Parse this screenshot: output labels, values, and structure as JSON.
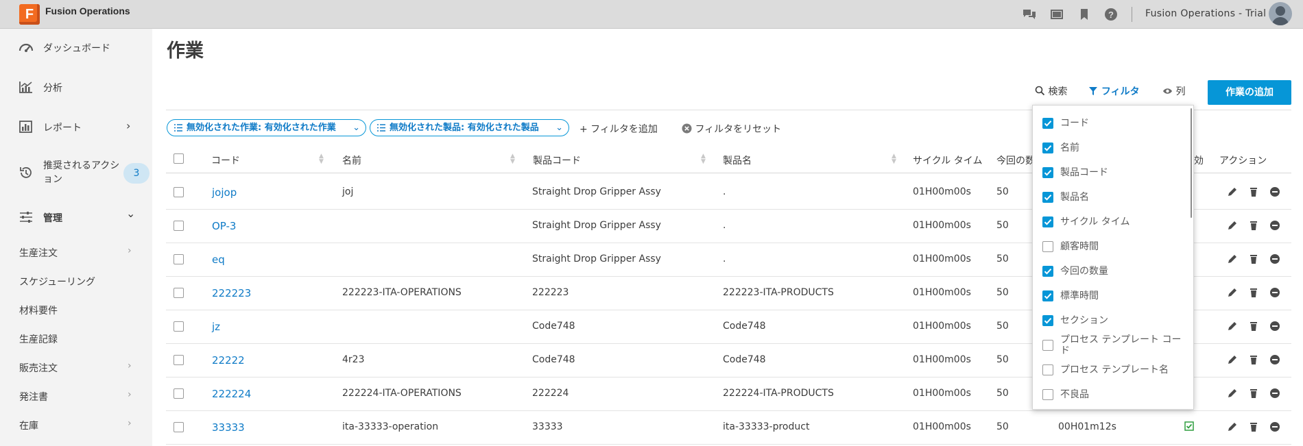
{
  "app": {
    "logo_letter": "F",
    "title": "Fusion Operations",
    "account": "Fusion Operations - Trial"
  },
  "topbar_icons": [
    "chat-icon",
    "screen-icon",
    "bookmark-icon",
    "help-icon"
  ],
  "sidebar": {
    "main_items": [
      {
        "label": "ダッシュボード",
        "icon": "dashboard-icon"
      },
      {
        "label": "分析",
        "icon": "analytics-icon"
      },
      {
        "label": "レポート",
        "icon": "report-icon",
        "chevron": "›"
      },
      {
        "label": "推奨されるアクション",
        "icon": "history-icon",
        "badge": "3"
      },
      {
        "label": "管理",
        "icon": "sliders-icon",
        "chevron": "⌄"
      }
    ],
    "sub_items": [
      {
        "label": "生産注文",
        "chevron": "›"
      },
      {
        "label": "スケジューリング"
      },
      {
        "label": "材料要件"
      },
      {
        "label": "生産記録"
      },
      {
        "label": "販売注文",
        "chevron": "›"
      },
      {
        "label": "発注書",
        "chevron": "›"
      },
      {
        "label": "在庫",
        "chevron": "›"
      }
    ]
  },
  "page": {
    "title": "作業"
  },
  "toolbar": {
    "search": "検索",
    "filter": "フィルタ",
    "columns": "列",
    "add": "作業の追加"
  },
  "filters": {
    "chips": [
      "無効化された作業: 有効化された作業",
      "無効化された製品: 有効化された製品"
    ],
    "add_filter": "+ フィルタを追加",
    "reset_filter": "フィルタをリセット"
  },
  "table": {
    "headers": {
      "code": "コード",
      "name": "名前",
      "product_code": "製品コード",
      "product_name": "製品名",
      "cycle_time": "サイクル タイム",
      "quantity": "今回の数",
      "enabled": "効",
      "actions": "アクション"
    },
    "rows": [
      {
        "code": "jojop",
        "name": "joj",
        "product_code": "Straight Drop Gripper Assy",
        "product_name": ".",
        "cycle_time": "01H00m00s",
        "quantity": "50",
        "standard_time": ""
      },
      {
        "code": "OP-3",
        "name": "",
        "product_code": "Straight Drop Gripper Assy",
        "product_name": ".",
        "cycle_time": "01H00m00s",
        "quantity": "50",
        "standard_time": ""
      },
      {
        "code": "eq",
        "name": "",
        "product_code": "Straight Drop Gripper Assy",
        "product_name": ".",
        "cycle_time": "01H00m00s",
        "quantity": "50",
        "standard_time": ""
      },
      {
        "code": "222223",
        "name": "222223-ITA-OPERATIONS",
        "product_code": "222223",
        "product_name": "222223-ITA-PRODUCTS",
        "cycle_time": "01H00m00s",
        "quantity": "50",
        "standard_time": ""
      },
      {
        "code": "jz",
        "name": "",
        "product_code": "Code748",
        "product_name": "Code748",
        "cycle_time": "01H00m00s",
        "quantity": "50",
        "standard_time": ""
      },
      {
        "code": "22222",
        "name": "4r23",
        "product_code": "Code748",
        "product_name": "Code748",
        "cycle_time": "01H00m00s",
        "quantity": "50",
        "standard_time": ""
      },
      {
        "code": "222224",
        "name": "222224-ITA-OPERATIONS",
        "product_code": "222224",
        "product_name": "222224-ITA-PRODUCTS",
        "cycle_time": "01H00m00s",
        "quantity": "50",
        "standard_time": ""
      },
      {
        "code": "33333",
        "name": "ita-33333-operation",
        "product_code": "33333",
        "product_name": "ita-33333-product",
        "cycle_time": "01H00m00s",
        "quantity": "50",
        "standard_time": "00H01m12s"
      }
    ]
  },
  "column_panel": {
    "options": [
      {
        "label": "コード",
        "checked": true
      },
      {
        "label": "名前",
        "checked": true
      },
      {
        "label": "製品コード",
        "checked": true
      },
      {
        "label": "製品名",
        "checked": true
      },
      {
        "label": "サイクル タイム",
        "checked": true
      },
      {
        "label": "顧客時間",
        "checked": false
      },
      {
        "label": "今回の数量",
        "checked": true
      },
      {
        "label": "標準時間",
        "checked": true
      },
      {
        "label": "セクション",
        "checked": true
      },
      {
        "label": "プロセス テンプレート コード",
        "checked": false
      },
      {
        "label": "プロセス テンプレート名",
        "checked": false
      },
      {
        "label": "不良品",
        "checked": false
      }
    ]
  },
  "colors": {
    "accent": "#0696d7",
    "link": "#0f7bc7",
    "logo": "#f26b21",
    "success": "#2e9e3f"
  }
}
